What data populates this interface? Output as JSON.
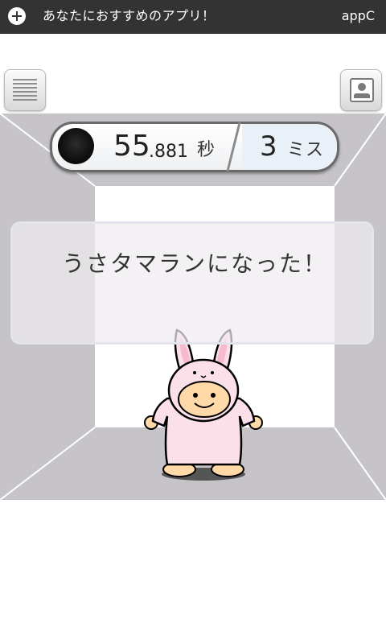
{
  "ad_bar": {
    "text": "あなたにおすすめのアプリ！",
    "brand": "appC"
  },
  "icons": {
    "ad": "plus-circle-icon",
    "menu": "menu-lines-icon",
    "screenshot": "photo-frame-icon",
    "indicator": "black-ball-icon",
    "character": "bunny-costume-child"
  },
  "score": {
    "time_int": "55",
    "time_dec": ".881",
    "time_unit": "秒",
    "miss_count": "3",
    "miss_unit": "ミス"
  },
  "message": {
    "text": "うさタマランになった！"
  },
  "colors": {
    "ad_bar": "#333333",
    "room_wall": "#c6c4c8",
    "room_back": "#ffffff",
    "bunny_pink": "#fbe0ea",
    "skin": "#ffd9a8"
  }
}
